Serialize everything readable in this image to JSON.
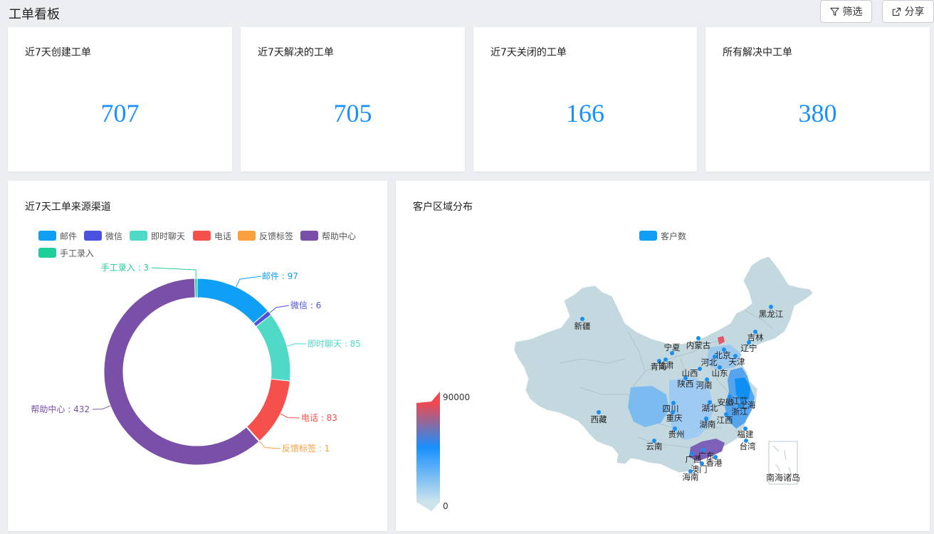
{
  "header": {
    "title": "工单看板",
    "filter_label": "筛选",
    "share_label": "分享"
  },
  "metrics": [
    {
      "title": "近7天创建工单",
      "value": "707"
    },
    {
      "title": "近7天解决的工单",
      "value": "705"
    },
    {
      "title": "近7天关闭的工单",
      "value": "166"
    },
    {
      "title": "所有解决中工单",
      "value": "380"
    }
  ],
  "source_chart": {
    "title": "近7天工单来源渠道"
  },
  "region_chart": {
    "title": "客户区域分布",
    "legend_label": "客户数",
    "visual_max": "90000",
    "visual_min": "0",
    "inset_label": "南海诸岛",
    "provinces": [
      "新疆",
      "西藏",
      "青海",
      "甘肃",
      "宁夏",
      "内蒙古",
      "黑龙江",
      "吉林",
      "辽宁",
      "北京",
      "天津",
      "河北",
      "山西",
      "山东",
      "陕西",
      "河南",
      "四川",
      "重庆",
      "湖北",
      "安徽",
      "江苏",
      "上海",
      "浙江",
      "江西",
      "湖南",
      "贵州",
      "云南",
      "福建",
      "台湾",
      "广西",
      "广东",
      "香港",
      "澳门",
      "海南"
    ]
  },
  "colors": {
    "accent": "#1890ff",
    "visual_high": "#f0484f",
    "visual_mid": "#1890ff",
    "visual_low": "#cde3ec"
  },
  "chart_data": {
    "type": "pie",
    "donut": true,
    "title": "近7天工单来源渠道",
    "legend_position": "top-left",
    "slices": [
      {
        "name": "邮件",
        "value": 97,
        "color": "#0fa0f5"
      },
      {
        "name": "微信",
        "value": 6,
        "color": "#4b52e0"
      },
      {
        "name": "即时聊天",
        "value": 85,
        "color": "#4fdac8"
      },
      {
        "name": "电话",
        "value": 83,
        "color": "#f5504c"
      },
      {
        "name": "反馈标签",
        "value": 1,
        "color": "#f9a03f"
      },
      {
        "name": "帮助中心",
        "value": 432,
        "color": "#7a4fa8"
      },
      {
        "name": "手工录入",
        "value": 3,
        "color": "#1fcf9a"
      }
    ]
  }
}
